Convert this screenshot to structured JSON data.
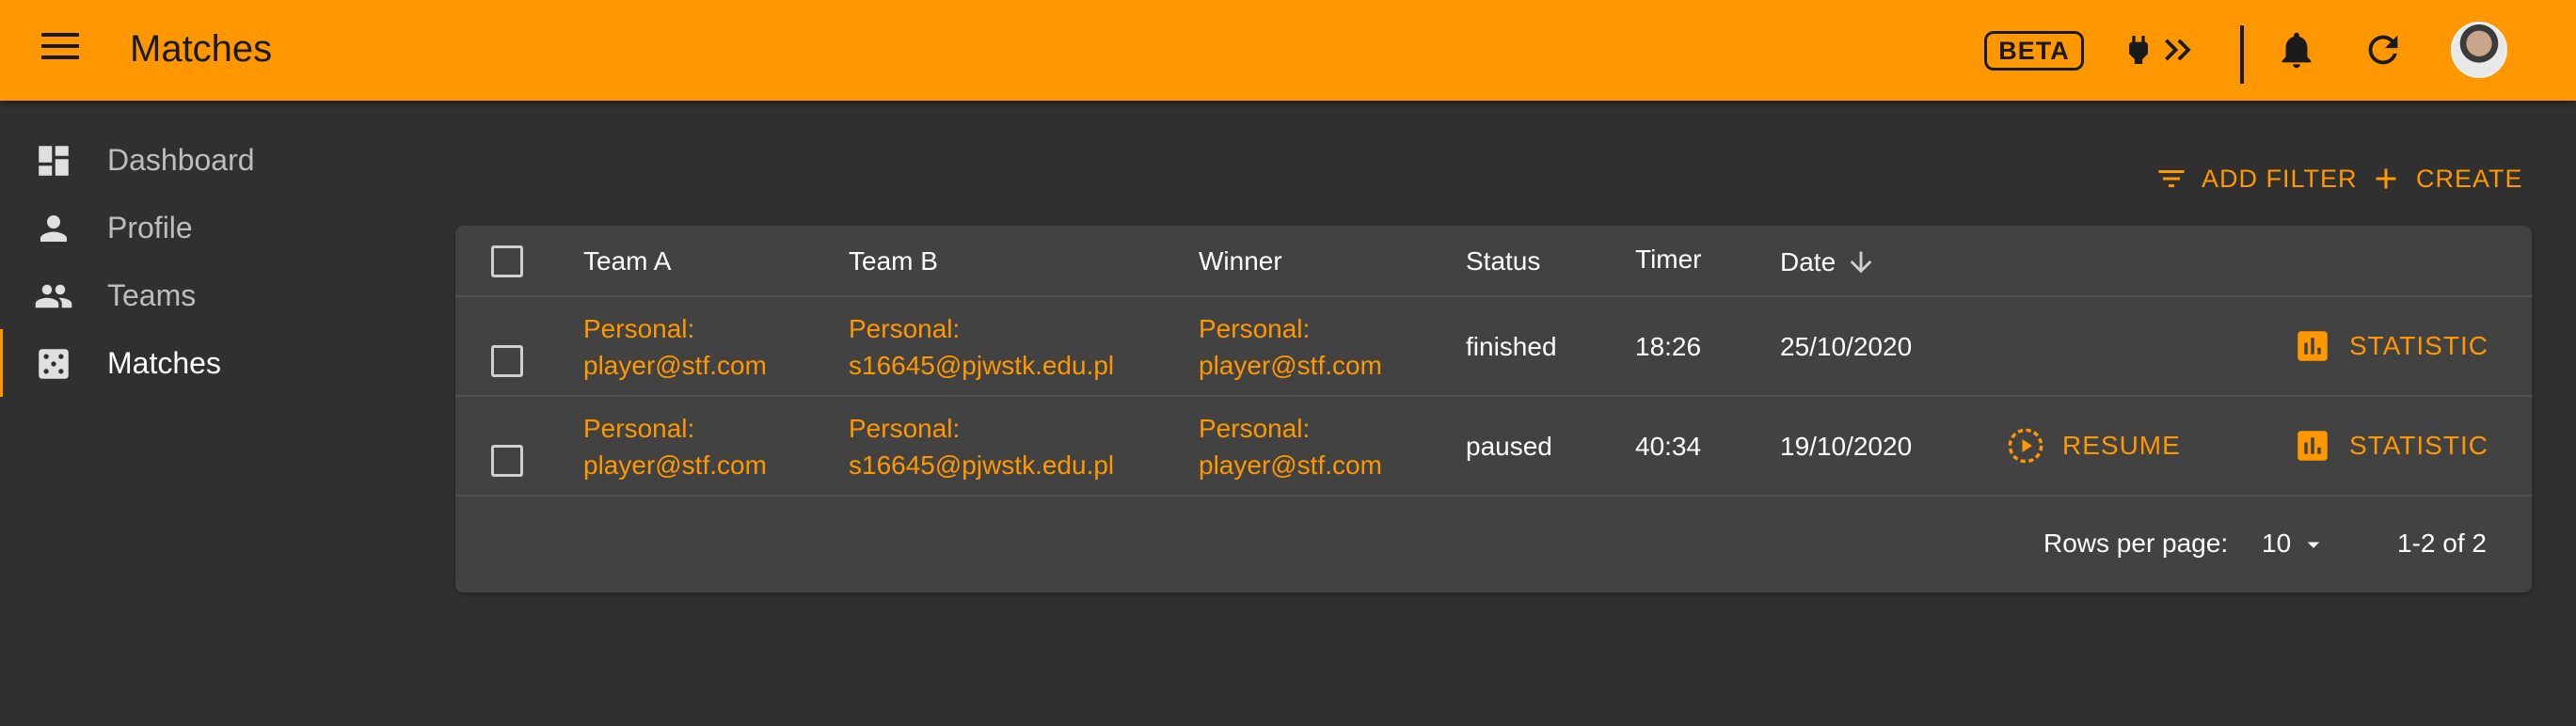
{
  "app": {
    "title": "Matches",
    "beta_label": "BETA"
  },
  "icons": {
    "menu": "hamburger-menu-icon",
    "plug": "power-plug-icon",
    "chevrons": "double-chevron-right-icon",
    "bell": "bell-icon",
    "refresh": "refresh-icon",
    "dashboard": "dashboard-icon",
    "profile": "person-icon",
    "teams": "people-icon",
    "matches": "dice-icon",
    "filter": "filter-icon",
    "create": "plus-icon",
    "sort": "arrow-down-icon",
    "resume": "play-circle-outline-icon",
    "statistic": "bar-chart-icon",
    "dropdown": "caret-down-icon"
  },
  "colors": {
    "accent": "#ff9800",
    "background": "#303030",
    "card": "#424242"
  },
  "sidebar": {
    "items": [
      {
        "label": "Dashboard",
        "active": false
      },
      {
        "label": "Profile",
        "active": false
      },
      {
        "label": "Teams",
        "active": false
      },
      {
        "label": "Matches",
        "active": true
      }
    ]
  },
  "toolbar": {
    "add_filter_label": "ADD FILTER",
    "create_label": "CREATE"
  },
  "table": {
    "columns": [
      "Team A",
      "Team B",
      "Winner",
      "Status",
      "Timer",
      "Date"
    ],
    "sorted_column": "Date",
    "sort_direction": "descending",
    "rows": [
      {
        "team_a": [
          "Personal:",
          "player@stf.com"
        ],
        "team_b": [
          "Personal:",
          "s16645@pjwstk.edu.pl"
        ],
        "winner": [
          "Personal:",
          "player@stf.com"
        ],
        "status": "finished",
        "timer": "18:26",
        "date": "25/10/2020",
        "resume_label": null,
        "statistic_label": "STATISTIC"
      },
      {
        "team_a": [
          "Personal:",
          "player@stf.com"
        ],
        "team_b": [
          "Personal:",
          "s16645@pjwstk.edu.pl"
        ],
        "winner": [
          "Personal:",
          "player@stf.com"
        ],
        "status": "paused",
        "timer": "40:34",
        "date": "19/10/2020",
        "resume_label": "RESUME",
        "statistic_label": "STATISTIC"
      }
    ]
  },
  "pagination": {
    "rows_per_page_label": "Rows per page:",
    "rows_per_page_value": "10",
    "range_label": "1-2 of 2"
  }
}
